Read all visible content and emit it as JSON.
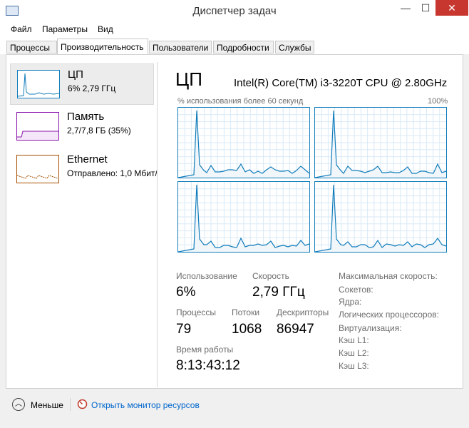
{
  "window": {
    "title": "Диспетчер задач",
    "min": "—",
    "max": "☐",
    "close": "✕"
  },
  "menu": [
    "Файл",
    "Параметры",
    "Вид"
  ],
  "tabs": [
    "Процессы",
    "Производительность",
    "Пользователи",
    "Подробности",
    "Службы"
  ],
  "sidebar": {
    "items": [
      {
        "title": "ЦП",
        "sub": "6% 2,79 ГГц",
        "color": "#117dbb",
        "selected": true
      },
      {
        "title": "Память",
        "sub": "2,7/7,8 ГБ (35%)",
        "color": "#8b12ae",
        "selected": false
      },
      {
        "title": "Ethernet",
        "sub": "Отправлено: 1,0 Мбит/",
        "color": "#a74f01",
        "selected": false
      }
    ]
  },
  "cpu": {
    "title": "ЦП",
    "model": "Intel(R) Core(TM) i3-3220T CPU @ 2.80GHz",
    "util_label": "% использования более 60 секунд",
    "util_max": "100%",
    "graph_color": "#117dbb"
  },
  "stats": {
    "usage_label": "Использование",
    "usage_value": "6%",
    "speed_label": "Скорость",
    "speed_value": "2,79 ГГц",
    "processes_label": "Процессы",
    "processes_value": "79",
    "threads_label": "Потоки",
    "threads_value": "1068",
    "handles_label": "Дескрипторы",
    "handles_value": "86947",
    "uptime_label": "Время работы",
    "uptime_value": "8:13:43:12"
  },
  "specs": [
    "Максимальная скорость:",
    "Сокетов:",
    "Ядра:",
    "Логических процессоров:",
    "Виртуализация:",
    "Кэш L1:",
    "Кэш L2:",
    "Кэш L3:"
  ],
  "footer": {
    "less": "Меньше",
    "monitor_link": "Открыть монитор ресурсов"
  }
}
